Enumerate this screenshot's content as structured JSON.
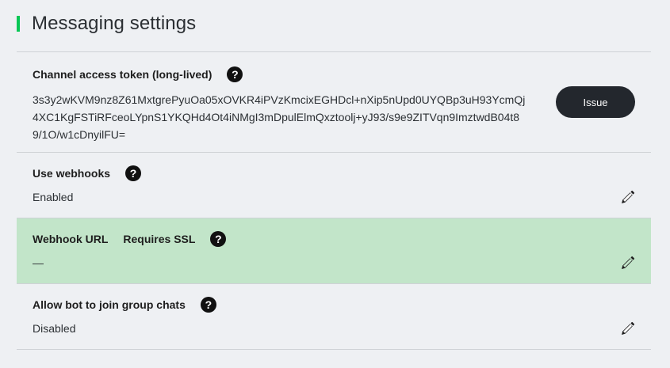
{
  "page": {
    "title": "Messaging settings",
    "accent_color": "#06c755"
  },
  "help_glyph": "?",
  "token_section": {
    "label": "Channel access token (long-lived)",
    "value": "3s3y2wKVM9nz8Z61MxtgrePyuOa05xOVKR4iPVzKmcixEGHDcl+nXip5nUpd0UYQBp3uH93YcmQj4XC1KgFSTiRFceoLYpnS1YKQHd4Ot4iNMgI3mDpulElmQxztoolj+yJ93/s9e9ZITVqn9ImztwdB04t89/1O/w1cDnyilFU=",
    "issue_button": "Issue"
  },
  "webhooks_section": {
    "label": "Use webhooks",
    "value": "Enabled"
  },
  "webhook_url_section": {
    "label": "Webhook URL",
    "note": "Requires SSL",
    "value": "—",
    "highlight_color": "#c2e5c9"
  },
  "group_section": {
    "label": "Allow bot to join group chats",
    "value": "Disabled"
  }
}
